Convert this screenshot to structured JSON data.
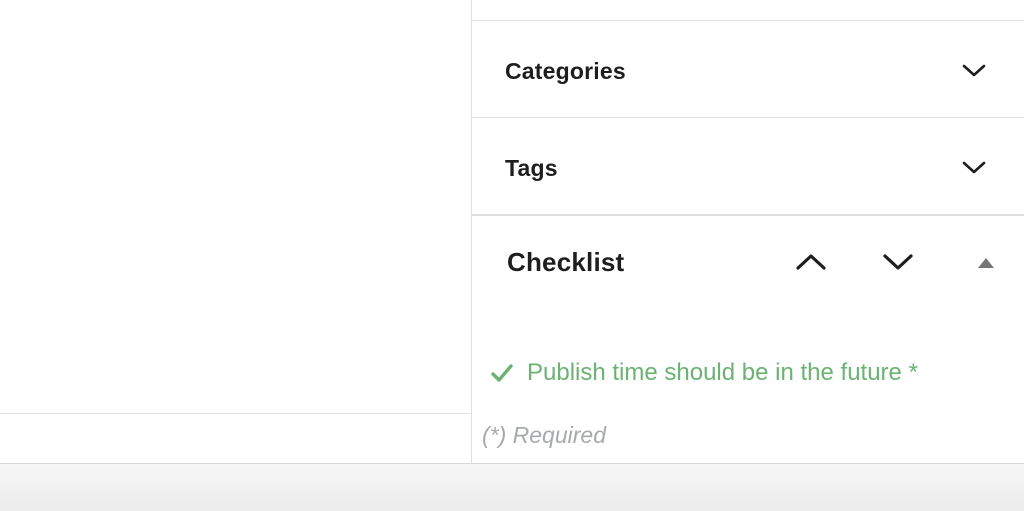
{
  "sidebar": {
    "panels": [
      {
        "title": "Categories",
        "toggle_icon": "chevron-down-icon"
      },
      {
        "title": "Tags",
        "toggle_icon": "chevron-down-icon"
      }
    ],
    "checklist": {
      "title": "Checklist",
      "controls": [
        "chevron-up-icon",
        "chevron-down-icon",
        "triangle-up-icon"
      ],
      "items": [
        {
          "text": "Publish time should be in the future *",
          "status": "complete",
          "icon": "checkmark-icon",
          "color": "#6bb273"
        }
      ],
      "required_note": "(*) Required"
    }
  },
  "colors": {
    "border": "#e0e0e0",
    "success": "#6bb273",
    "muted": "#a7aaad",
    "text": "#1e1e1e"
  }
}
